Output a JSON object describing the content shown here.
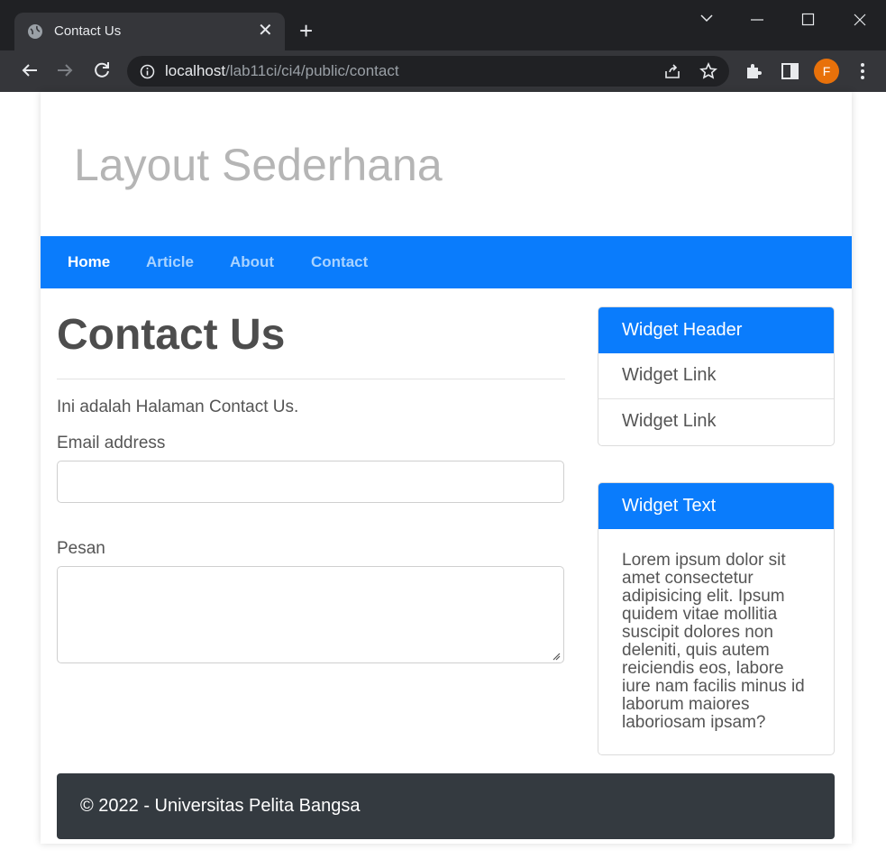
{
  "browser": {
    "tab_title": "Contact Us",
    "url_host": "localhost",
    "url_path": "/lab11ci/ci4/public/contact",
    "profile_initial": "F"
  },
  "site": {
    "title": "Layout Sederhana"
  },
  "nav": {
    "items": [
      "Home",
      "Article",
      "About",
      "Contact"
    ]
  },
  "main": {
    "heading": "Contact Us",
    "intro": "Ini adalah Halaman Contact Us.",
    "email_label": "Email address",
    "email_value": "",
    "message_label": "Pesan",
    "message_value": ""
  },
  "sidebar": {
    "widget1": {
      "header": "Widget Header",
      "links": [
        "Widget Link",
        "Widget Link"
      ]
    },
    "widget2": {
      "header": "Widget Text",
      "body": "Lorem ipsum dolor sit amet consectetur adipisicing elit. Ipsum quidem vitae mollitia suscipit dolores non deleniti, quis autem reiciendis eos, labore iure nam facilis minus id laborum maiores laboriosam ipsam?"
    }
  },
  "footer": {
    "text": "© 2022 - Universitas Pelita Bangsa"
  },
  "colors": {
    "nav_bg": "#0a7cfc",
    "footer_bg": "#343a40"
  }
}
